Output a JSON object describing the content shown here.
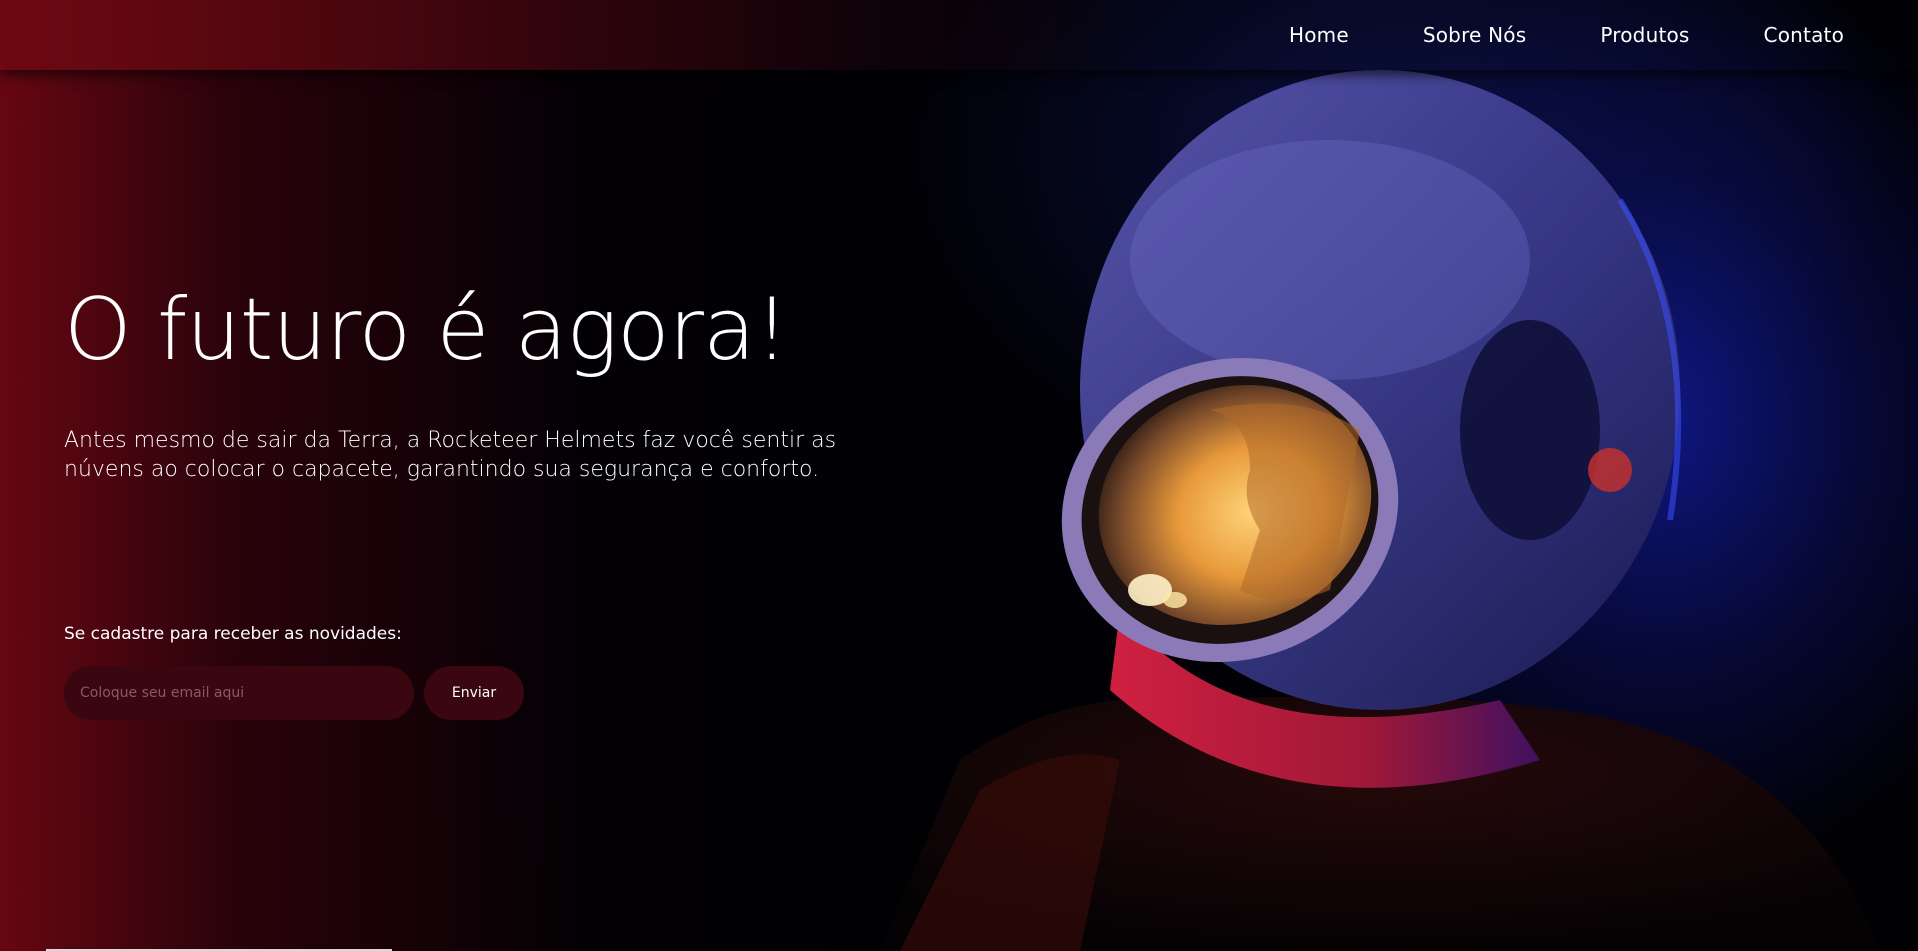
{
  "nav": {
    "items": [
      {
        "label": "Home"
      },
      {
        "label": "Sobre Nós"
      },
      {
        "label": "Produtos"
      },
      {
        "label": "Contato"
      }
    ]
  },
  "hero": {
    "title": "O futuro é agora!",
    "subtitle": "Antes mesmo de sair da Terra, a Rocketeer Helmets faz você sentir as núvens ao colocar o capacete, garantindo sua segurança e conforto."
  },
  "signup": {
    "label": "Se cadastre para receber as novidades:",
    "email_placeholder": "Coloque seu email aqui",
    "email_value": "",
    "button_label": "Enviar"
  },
  "colors": {
    "accent": "#3a0610",
    "nav_gradient_start": "#6e0812",
    "text": "#ffffff"
  }
}
